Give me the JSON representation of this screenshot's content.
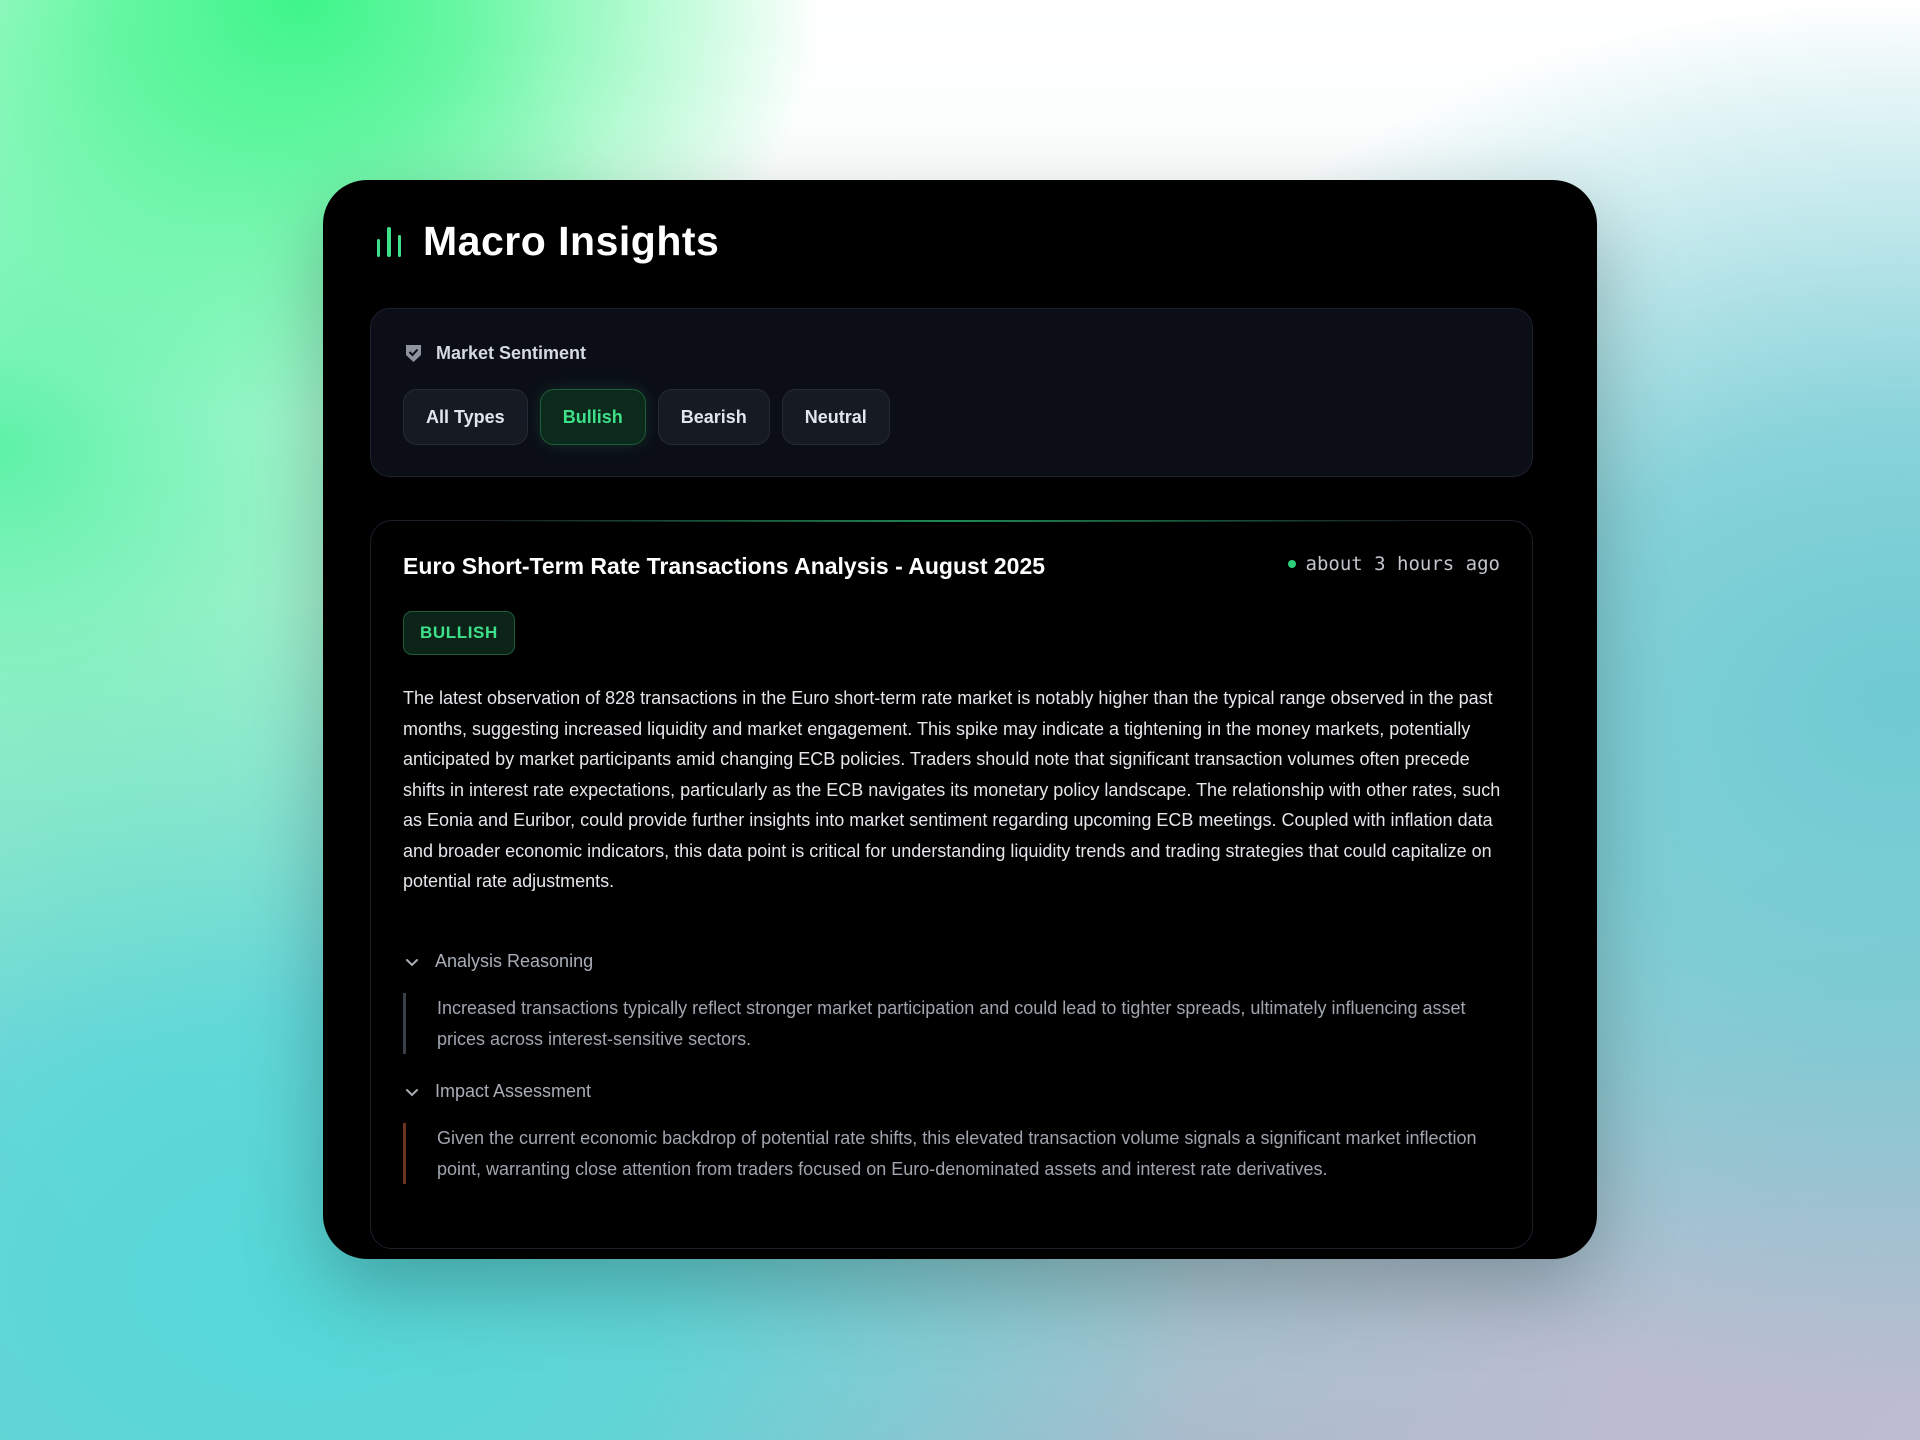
{
  "app": {
    "title": "Macro Insights"
  },
  "filter": {
    "label": "Market Sentiment",
    "options": [
      "All Types",
      "Bullish",
      "Bearish",
      "Neutral"
    ],
    "selected": "Bullish"
  },
  "insight": {
    "title": "Euro Short-Term Rate Transactions Analysis - August 2025",
    "time": "about 3 hours ago",
    "sentiment_badge": "BULLISH",
    "summary": "The latest observation of 828 transactions in the Euro short-term rate market is notably higher than the typical range observed in the past months, suggesting increased liquidity and market engagement. This spike may indicate a tightening in the money markets, potentially anticipated by market participants amid changing ECB policies. Traders should note that significant transaction volumes often precede shifts in interest rate expectations, particularly as the ECB navigates its monetary policy landscape. The relationship with other rates, such as Eonia and Euribor, could provide further insights into market sentiment regarding upcoming ECB meetings. Coupled with inflation data and broader economic indicators, this data point is critical for understanding liquidity trends and trading strategies that could capitalize on potential rate adjustments.",
    "sections": [
      {
        "label": "Analysis Reasoning",
        "body": "Increased transactions typically reflect stronger market participation and could lead to tighter spreads, ultimately influencing asset prices across interest-sensitive sectors.",
        "accent": "#3a3f4a"
      },
      {
        "label": "Impact Assessment",
        "body": "Given the current economic backdrop of potential rate shifts, this elevated transaction volume signals a significant market inflection point, warranting close attention from traders focused on Euro-denominated assets and interest rate derivatives.",
        "accent": "#6b3420"
      }
    ]
  },
  "colors": {
    "accent": "#3ee08a",
    "panel": "#000000",
    "filter_box": "#0b0e16"
  },
  "icons": {
    "header": "bar-chart-icon",
    "filter": "shield-check-icon",
    "toggle": "chevron-down-icon",
    "time": "status-dot-icon"
  }
}
